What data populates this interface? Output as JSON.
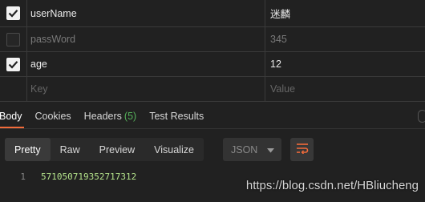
{
  "params": [
    {
      "key": "userName",
      "value": "迷麟",
      "checked": true,
      "dim": false
    },
    {
      "key": "passWord",
      "value": "345",
      "checked": false,
      "dim": true
    },
    {
      "key": "age",
      "value": "12",
      "checked": true,
      "dim": false
    }
  ],
  "params_placeholder": {
    "key": "Key",
    "value": "Value"
  },
  "response_tabs": {
    "body": "Body",
    "cookies": "Cookies",
    "headers": "Headers",
    "headers_count": "(5)",
    "test_results": "Test Results"
  },
  "format_buttons": {
    "pretty": "Pretty",
    "raw": "Raw",
    "preview": "Preview",
    "visualize": "Visualize"
  },
  "format_select": {
    "selected": "JSON"
  },
  "response_body": {
    "line_number": "1",
    "value": "571050719352717312"
  },
  "watermark": "https://blog.csdn.net/HBliucheng",
  "colors": {
    "accent": "#f26b3a",
    "background": "#212121",
    "code_value": "#b5e48c",
    "badge": "#55b05a"
  },
  "icons": [
    "checkbox-checked-icon",
    "checkbox-empty-icon",
    "dropdown-arrow-icon",
    "wrap-lines-icon"
  ]
}
